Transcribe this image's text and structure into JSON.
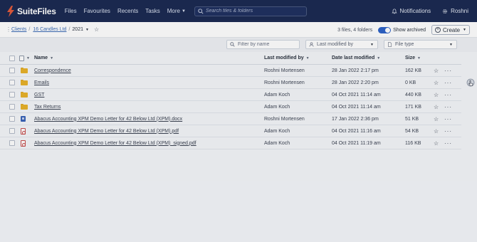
{
  "app": {
    "name": "SuiteFiles"
  },
  "nav": {
    "items": [
      "Files",
      "Favourites",
      "Recents",
      "Tasks"
    ],
    "more_label": "More",
    "search_placeholder": "Search files & folders",
    "notifications_label": "Notifications",
    "user_name": "Roshni"
  },
  "breadcrumb": {
    "items": [
      "Clients",
      "16 Candles Ltd"
    ],
    "current": "2021"
  },
  "toolbar": {
    "count": "3 files, 4 folders",
    "show_archived_label": "Show archived",
    "show_archived_on": true,
    "create_label": "Create"
  },
  "filters": {
    "name_placeholder": "Filter by name",
    "modified_by_placeholder": "Last modified by",
    "file_type_placeholder": "File type"
  },
  "table": {
    "headers": {
      "name": "Name",
      "modified_by": "Last modified by",
      "date": "Date last modified",
      "size": "Size"
    },
    "rows": [
      {
        "icon": "folder-icon",
        "name": "Correspondence",
        "modified_by": "Roshni Mortensen",
        "date": "28 Jan 2022 2:17 pm",
        "size": "162 KB"
      },
      {
        "icon": "folder-icon",
        "name": "Emails",
        "modified_by": "Roshni Mortensen",
        "date": "28 Jan 2022 2:20 pm",
        "size": "0 KB"
      },
      {
        "icon": "folder-icon",
        "name": "GST",
        "modified_by": "Adam Koch",
        "date": "04 Oct 2021 11:14 am",
        "size": "440 KB"
      },
      {
        "icon": "folder-icon",
        "name": "Tax Returns",
        "modified_by": "Adam Koch",
        "date": "04 Oct 2021 11:14 am",
        "size": "171 KB"
      },
      {
        "icon": "docx-icon",
        "name": "Abacus Accounting XPM Demo Letter for 42 Below Ltd (XPM).docx",
        "modified_by": "Roshni Mortensen",
        "date": "17 Jan 2022 2:36 pm",
        "size": "51 KB"
      },
      {
        "icon": "pdf-icon",
        "name": "Abacus Accounting XPM Demo Letter for 42 Below Ltd (XPM).pdf",
        "modified_by": "Adam Koch",
        "date": "04 Oct 2021 11:16 am",
        "size": "54 KB"
      },
      {
        "icon": "pdf-icon",
        "name": "Abacus Accounting XPM Demo Letter for 42 Below Ltd (XPM)_signed.pdf",
        "modified_by": "Adam Koch",
        "date": "04 Oct 2021 11:19 am",
        "size": "116 KB"
      }
    ]
  },
  "colors": {
    "nav_bg": "#1b2a52",
    "accent": "#2d62c7",
    "folder": "#e8b22a"
  }
}
